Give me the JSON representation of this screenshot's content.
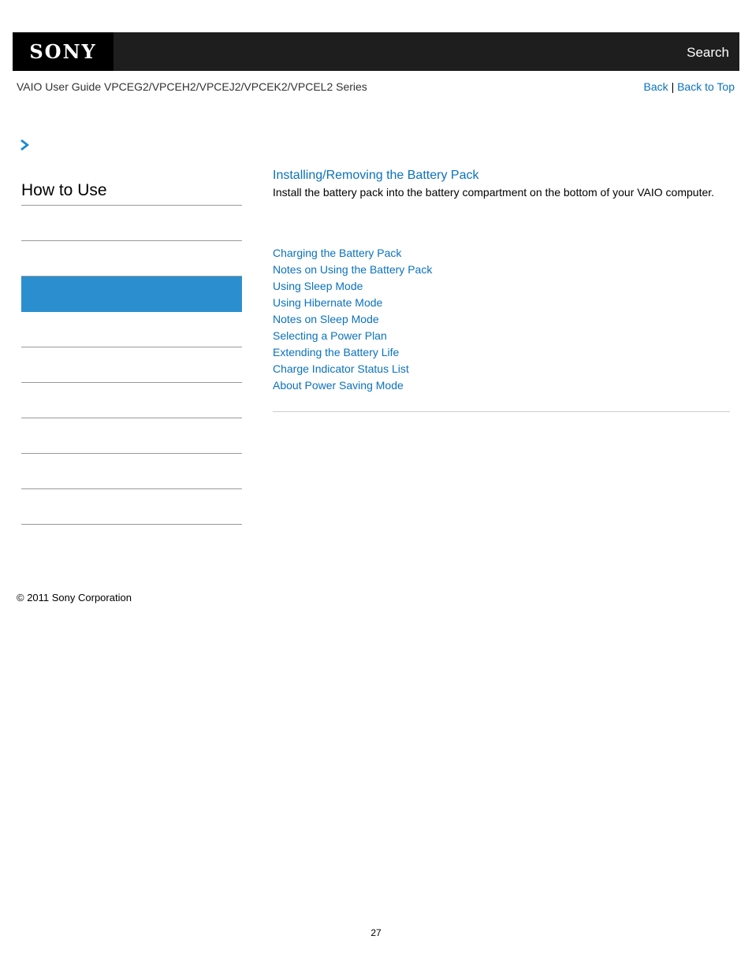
{
  "header": {
    "logo": "SONY",
    "search_label": "Search"
  },
  "guide_title": "VAIO User Guide VPCEG2/VPCEH2/VPCEJ2/VPCEK2/VPCEL2 Series",
  "nav": {
    "back": "Back",
    "separator": "|",
    "back_to_top": "Back to Top"
  },
  "breadcrumb_icon": "chevron-right-icon",
  "sidebar": {
    "title": "How to Use",
    "items": [
      {
        "label": ""
      },
      {
        "label": ""
      },
      {
        "label": "",
        "active": true
      },
      {
        "label": ""
      },
      {
        "label": ""
      },
      {
        "label": ""
      },
      {
        "label": ""
      },
      {
        "label": ""
      },
      {
        "label": ""
      }
    ]
  },
  "content": {
    "title": "Installing/Removing the Battery Pack",
    "description": "Install the battery pack into the battery compartment on the bottom of your VAIO computer.",
    "related_links": [
      "Charging the Battery Pack",
      "Notes on Using the Battery Pack",
      "Using Sleep Mode",
      "Using Hibernate Mode",
      "Notes on Sleep Mode",
      "Selecting a Power Plan",
      "Extending the Battery Life",
      "Charge Indicator Status List",
      "About Power Saving Mode"
    ]
  },
  "footer": {
    "copyright": "© 2011 Sony Corporation",
    "page_number": "27"
  },
  "colors": {
    "link": "#0b72bc",
    "active_sidebar": "#2b8fcf",
    "topbar": "#1e1e1e"
  }
}
